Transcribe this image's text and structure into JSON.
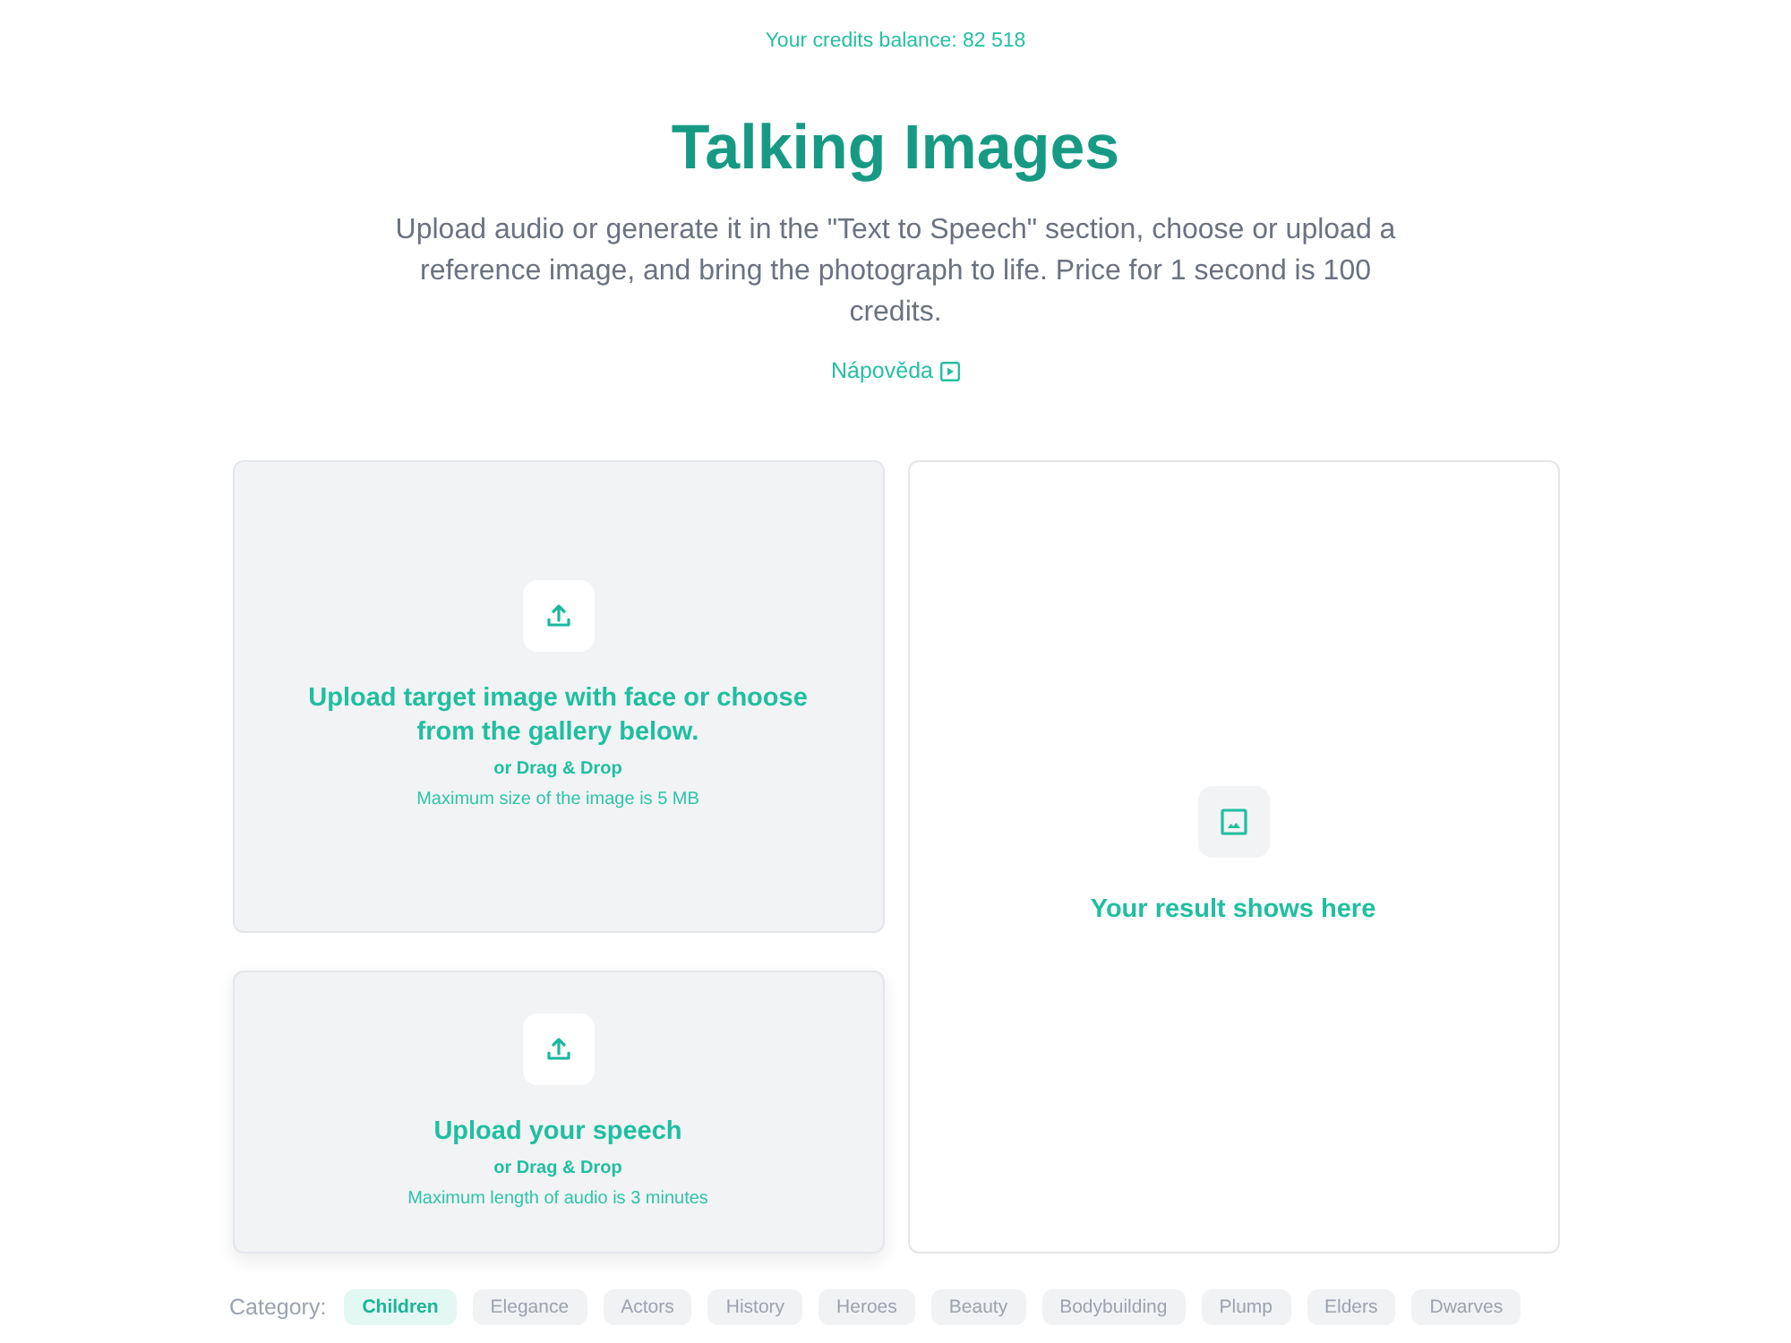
{
  "credits": "Your credits balance: 82 518",
  "title": "Talking Images",
  "description": "Upload audio or generate it in the \"Text to Speech\" section, choose or upload a reference image, and bring the photograph to life. Price for 1 second is 100 credits.",
  "help_link": {
    "label": "Nápověda"
  },
  "image_upload": {
    "title": "Upload target image with face or choose from the gallery below.",
    "hint": "or Drag & Drop",
    "limit": "Maximum size of the image is 5 MB"
  },
  "speech_upload": {
    "title": "Upload your speech",
    "hint": "or Drag & Drop",
    "limit": "Maximum length of audio is 3 minutes"
  },
  "result": {
    "message": "Your result shows here"
  },
  "categories": {
    "label": "Category:",
    "items": [
      {
        "label": "Children",
        "selected": true
      },
      {
        "label": "Elegance",
        "selected": false
      },
      {
        "label": "Actors",
        "selected": false
      },
      {
        "label": "History",
        "selected": false
      },
      {
        "label": "Heroes",
        "selected": false
      },
      {
        "label": "Beauty",
        "selected": false
      },
      {
        "label": "Bodybuilding",
        "selected": false
      },
      {
        "label": "Plump",
        "selected": false
      },
      {
        "label": "Elders",
        "selected": false
      },
      {
        "label": "Dwarves",
        "selected": false
      }
    ]
  }
}
